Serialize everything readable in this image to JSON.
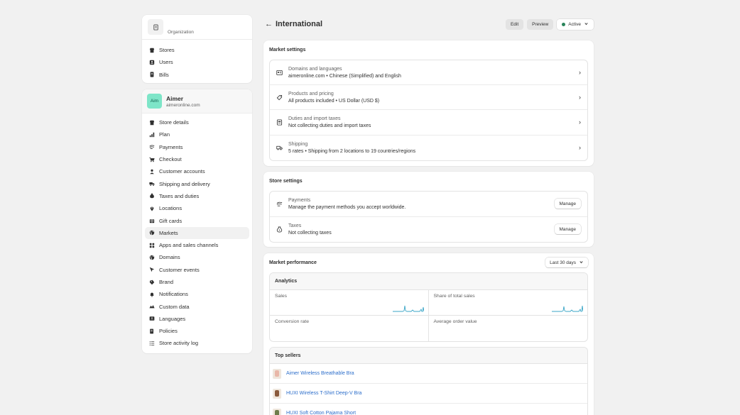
{
  "sidebar": {
    "org_label": "Organization",
    "org_items": [
      {
        "label": "Stores",
        "icon": "store-icon"
      },
      {
        "label": "Users",
        "icon": "users-icon"
      },
      {
        "label": "Bills",
        "icon": "bill-icon"
      }
    ],
    "store": {
      "avatar": "Aim",
      "name": "Aimer",
      "domain": "aimeronline.com"
    },
    "store_items": [
      {
        "label": "Store details",
        "icon": "store-icon"
      },
      {
        "label": "Plan",
        "icon": "plan-icon"
      },
      {
        "label": "Payments",
        "icon": "payments-icon"
      },
      {
        "label": "Checkout",
        "icon": "cart-icon"
      },
      {
        "label": "Customer accounts",
        "icon": "person-icon"
      },
      {
        "label": "Shipping and delivery",
        "icon": "truck-icon"
      },
      {
        "label": "Taxes and duties",
        "icon": "tax-icon"
      },
      {
        "label": "Locations",
        "icon": "location-icon"
      },
      {
        "label": "Gift cards",
        "icon": "gift-icon"
      },
      {
        "label": "Markets",
        "icon": "globe-icon",
        "active": true
      },
      {
        "label": "Apps and sales channels",
        "icon": "apps-icon"
      },
      {
        "label": "Domains",
        "icon": "globe-icon"
      },
      {
        "label": "Customer events",
        "icon": "events-icon"
      },
      {
        "label": "Brand",
        "icon": "brand-icon"
      },
      {
        "label": "Notifications",
        "icon": "bell-icon"
      },
      {
        "label": "Custom data",
        "icon": "data-icon"
      },
      {
        "label": "Languages",
        "icon": "language-icon"
      },
      {
        "label": "Policies",
        "icon": "policy-icon"
      },
      {
        "label": "Store activity log",
        "icon": "list-icon"
      }
    ]
  },
  "header": {
    "title": "International",
    "edit_label": "Edit",
    "preview_label": "Preview",
    "status_label": "Active",
    "status_color": "#29845a"
  },
  "market_settings": {
    "title": "Market settings",
    "rows": [
      {
        "title": "Domains and languages",
        "sub": "aimeronline.com • Chinese (Simplified) and English",
        "icon": "domain-icon"
      },
      {
        "title": "Products and pricing",
        "sub": "All products included • US Dollar (USD $)",
        "icon": "tag-icon"
      },
      {
        "title": "Duties and import taxes",
        "sub": "Not collecting duties and import taxes",
        "icon": "duties-icon"
      },
      {
        "title": "Shipping",
        "sub": "5 rates • Shipping from 2 locations to 19 countries/regions",
        "icon": "truck-icon"
      }
    ]
  },
  "store_settings": {
    "title": "Store settings",
    "rows": [
      {
        "title": "Payments",
        "sub": "Manage the payment methods you accept worldwide.",
        "button": "Manage",
        "icon": "payments-icon"
      },
      {
        "title": "Taxes",
        "sub": "Not collecting taxes",
        "button": "Manage",
        "icon": "tax-icon"
      }
    ]
  },
  "performance": {
    "title": "Market performance",
    "range": "Last 30 days",
    "analytics_title": "Analytics",
    "metrics": {
      "sales": "Sales",
      "share": "Share of total sales",
      "conversion": "Conversion rate",
      "aov": "Average order value"
    },
    "spark_color": "#3aa6c7",
    "top_sellers_title": "Top sellers",
    "sellers": [
      {
        "name": "Aimer Wireless Breathable Bra",
        "color": "#e9b7a8"
      },
      {
        "name": "HUXI Wireless T-Shirt Deep-V Bra",
        "color": "#8a5a3c"
      },
      {
        "name": "HUXI Soft Cotton Pajama Short",
        "color": "#6f7d4b"
      }
    ]
  }
}
